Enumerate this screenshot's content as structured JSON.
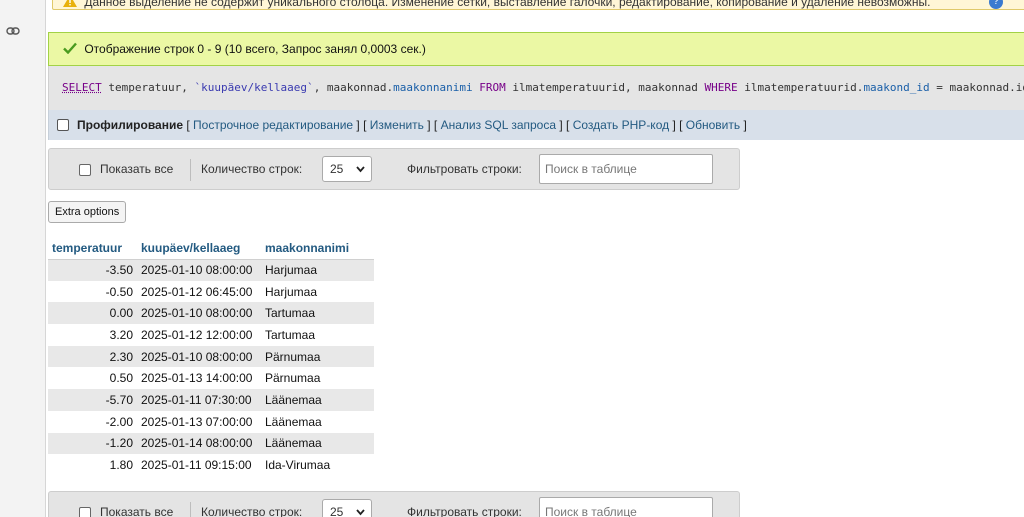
{
  "warning": {
    "text": "Данное выделение не содержит уникального столбца. Изменение сетки, выставление галочки, редактирование, копирование и удаление невозможны."
  },
  "success": {
    "text": "Отображение строк 0 - 9 (10 всего, Запрос занял 0,0003 сек.)"
  },
  "sql": {
    "select": "SELECT",
    "p1": " temperatuur, ",
    "quoted": "`kuupäev/kellaaeg`",
    "p2": ", maakonnad.",
    "f1": "maakonnanimi",
    "from": " FROM",
    "p3": " ilmatemperatuurid, maakonnad ",
    "where": "WHERE",
    "p4": " ilmatemperatuurid.",
    "f2": "maakond_id",
    "p5": " = maakonnad.id"
  },
  "profiling": {
    "label": "Профилирование",
    "links": [
      "Построчное редактирование",
      "Изменить",
      "Анализ SQL запроса",
      "Создать PHP-код",
      "Обновить"
    ]
  },
  "toolbar": {
    "show_all": "Показать все",
    "rows_label": "Количество строк:",
    "rows_value": "25",
    "filter_label": "Фильтровать строки:",
    "filter_placeholder": "Поиск в таблице"
  },
  "extra_options": "Extra options",
  "table": {
    "columns": [
      "temperatuur",
      "kuupäev/kellaaeg",
      "maakonnanimi"
    ],
    "rows": [
      [
        "-3.50",
        "2025-01-10 08:00:00",
        "Harjumaa"
      ],
      [
        "-0.50",
        "2025-01-12 06:45:00",
        "Harjumaa"
      ],
      [
        "0.00",
        "2025-01-10 08:00:00",
        "Tartumaa"
      ],
      [
        "3.20",
        "2025-01-12 12:00:00",
        "Tartumaa"
      ],
      [
        "2.30",
        "2025-01-10 08:00:00",
        "Pärnumaa"
      ],
      [
        "0.50",
        "2025-01-13 14:00:00",
        "Pärnumaa"
      ],
      [
        "-5.70",
        "2025-01-11 07:30:00",
        "Läänemaa"
      ],
      [
        "-2.00",
        "2025-01-13 07:00:00",
        "Läänemaa"
      ],
      [
        "-1.20",
        "2025-01-14 08:00:00",
        "Läänemaa"
      ],
      [
        "1.80",
        "2025-01-11 09:15:00",
        "Ida-Virumaa"
      ]
    ]
  },
  "icons": {
    "rail": "link-icon",
    "warning": "warning-icon",
    "success": "check-icon",
    "help": "help-icon",
    "select": "chevron-down-icon"
  },
  "colors": {
    "success_bg": "#ebf8a4",
    "link": "#235a81",
    "sql_keyword": "#770088"
  }
}
